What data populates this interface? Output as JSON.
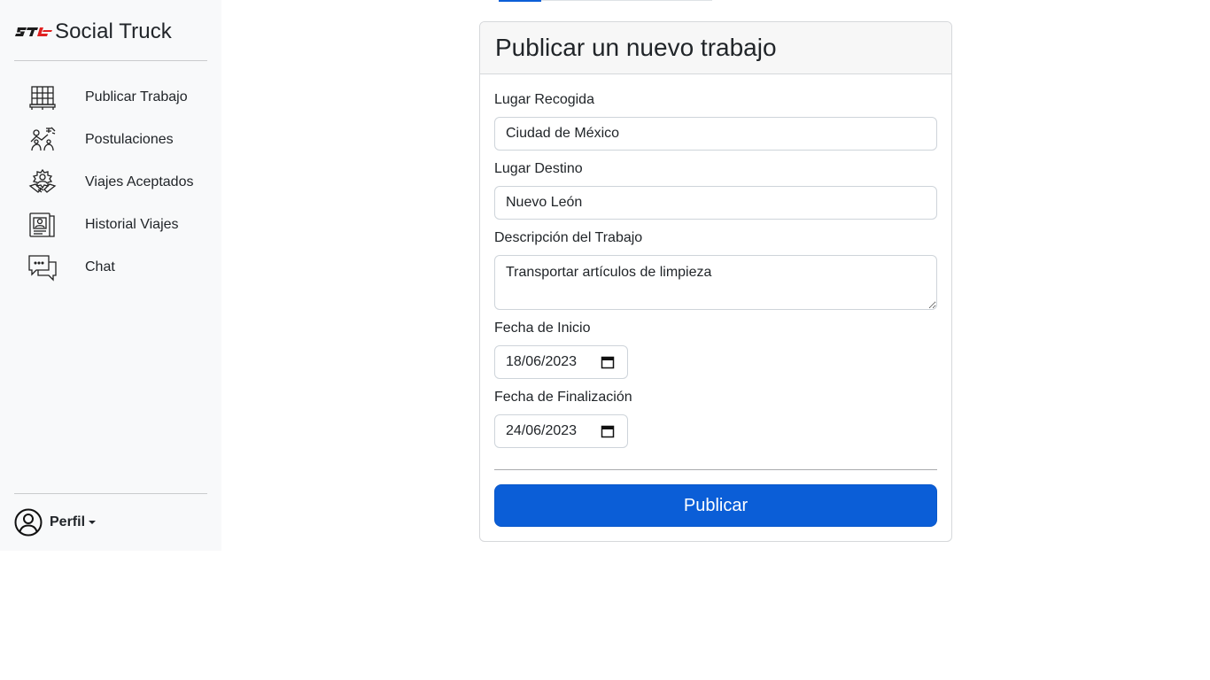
{
  "brand": {
    "name": "Social Truck",
    "logo_icon": "st-truck-logo"
  },
  "sidebar": {
    "items": [
      {
        "label": "Publicar Trabajo",
        "icon": "pallet-boxes-icon"
      },
      {
        "label": "Postulaciones",
        "icon": "worker-hands-icon"
      },
      {
        "label": "Viajes Aceptados",
        "icon": "handshake-gear-icon"
      },
      {
        "label": "Historial Viajes",
        "icon": "id-card-folder-icon"
      },
      {
        "label": "Chat",
        "icon": "chat-bubbles-icon"
      }
    ],
    "profile_label": "Perfil"
  },
  "form": {
    "title": "Publicar un nuevo trabajo",
    "pickup_label": "Lugar Recogida",
    "pickup_value": "Ciudad de México",
    "destination_label": "Lugar Destino",
    "destination_value": "Nuevo León",
    "description_label": "Descripción del Trabajo",
    "description_value": "Transportar artículos de limpieza",
    "start_label": "Fecha de Inicio",
    "start_value": "18/06/2023",
    "end_label": "Fecha de Finalización",
    "end_value": "24/06/2023",
    "submit_label": "Publicar"
  },
  "colors": {
    "primary": "#0b5ed7",
    "sidebar_bg": "#f8f9fa",
    "logo_red": "#e02020"
  }
}
